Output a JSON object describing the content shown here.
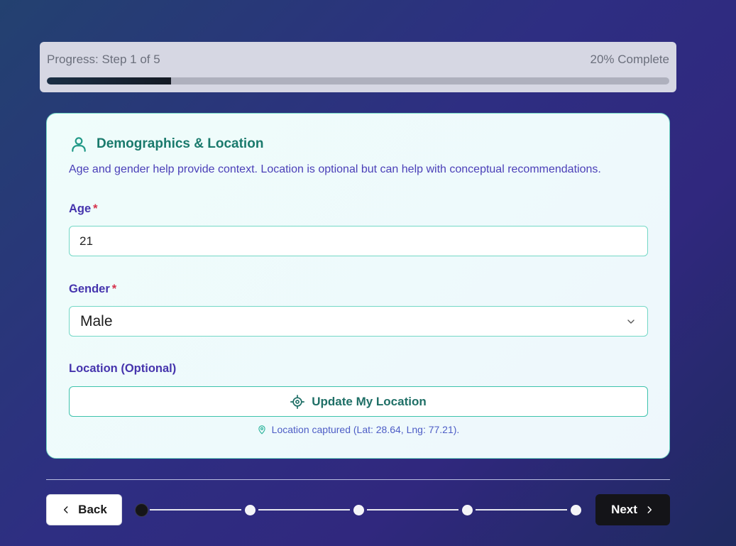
{
  "progress": {
    "step_text": "Progress: Step 1 of 5",
    "percent_text": "20% Complete",
    "fraction": 0.2
  },
  "section": {
    "title": "Demographics & Location",
    "icon": "user-icon",
    "description": "Age and gender help provide context. Location is optional but can help with conceptual recommendations."
  },
  "fields": {
    "age": {
      "label": "Age",
      "required_mark": "*",
      "value": "21"
    },
    "gender": {
      "label": "Gender",
      "required_mark": "*",
      "selected": "Male"
    },
    "location": {
      "label": "Location (Optional)",
      "button_label": "Update My Location",
      "status": "Location captured (Lat: 28.64, Lng: 77.21)."
    }
  },
  "navigation": {
    "back_label": "Back",
    "next_label": "Next",
    "total_steps": 5,
    "current_step": 1
  },
  "colors": {
    "accent_teal": "#1a7a6c",
    "label_purple": "#4534ad",
    "required_red": "#d6324b"
  }
}
